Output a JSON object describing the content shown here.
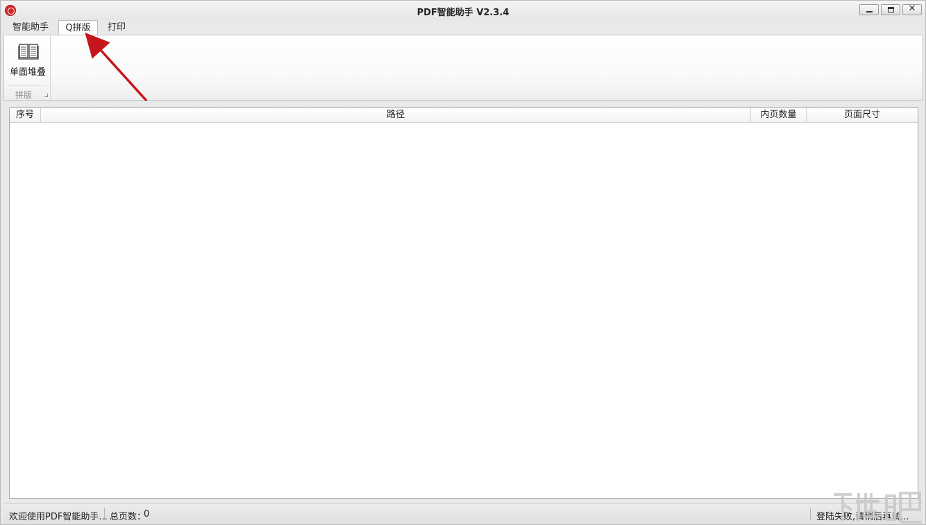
{
  "window": {
    "title": "PDF智能助手 V2.3.4",
    "controls": [
      "minimize",
      "maximize",
      "close"
    ]
  },
  "tabs": [
    {
      "label": "智能助手",
      "active": false
    },
    {
      "label": "Q拼版",
      "active": true
    },
    {
      "label": "打印",
      "active": false
    }
  ],
  "ribbon": {
    "groups": [
      {
        "label": "拼版",
        "buttons": [
          {
            "label": "单面堆叠",
            "icon": "open-book-icon"
          }
        ]
      }
    ]
  },
  "table": {
    "columns": [
      "序号",
      "路径",
      "内页数量",
      "页面尺寸"
    ],
    "rows": []
  },
  "statusbar": {
    "welcome": "欢迎使用PDF智能助手...",
    "total_pages_label": "总页数：",
    "total_pages_value": "0",
    "login_status": "登陆失败,请稍后再试..."
  },
  "colors": {
    "accent_arrow": "#c4161c",
    "app_icon": "#d8262a"
  }
}
